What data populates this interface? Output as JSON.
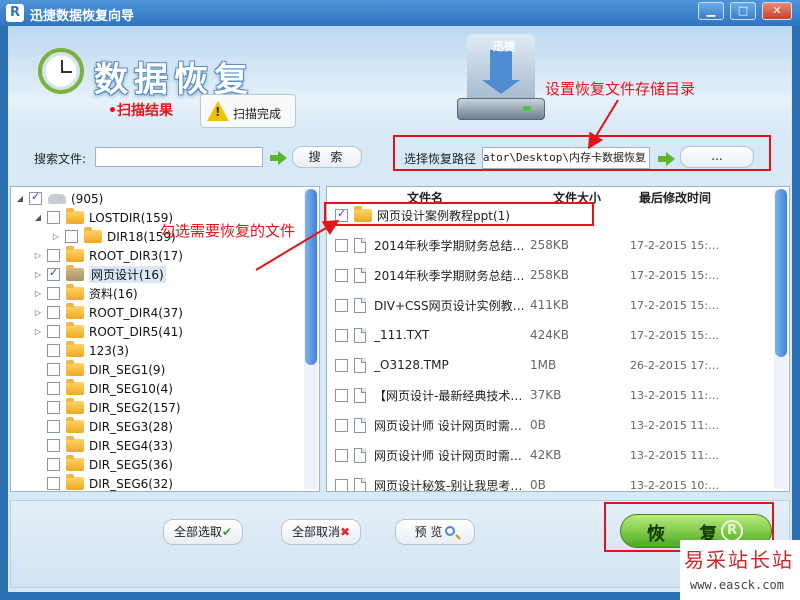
{
  "window": {
    "title": "迅捷数据恢复向导",
    "logo_letter": "R",
    "min": "▁",
    "max": "□",
    "close": "✕"
  },
  "header": {
    "big_title": "数据恢复",
    "scan_result": "•扫描结果",
    "scan_status": "扫描完成",
    "hdd_label": "迅捷"
  },
  "search": {
    "label": "搜索文件:",
    "value": "",
    "button": "搜 索"
  },
  "path": {
    "label": "选择恢复路径",
    "value": "C:\\Users\\Administrator\\Desktop\\内存卡数据恢复",
    "browse": "..."
  },
  "tree": [
    {
      "label": "(905)",
      "checked": true,
      "expander": "◢",
      "indent": 0,
      "icon": "drive-icon"
    },
    {
      "label": "LOSTDIR(159)",
      "checked": false,
      "expander": "◢",
      "indent": 1,
      "icon": "folder-icon"
    },
    {
      "label": "DIR18(159)",
      "checked": false,
      "expander": "▷",
      "indent": 2,
      "icon": "folder-icon"
    },
    {
      "label": "ROOT_DIR3(17)",
      "checked": false,
      "expander": "▷",
      "indent": 1,
      "icon": "folder-icon"
    },
    {
      "label": "网页设计(16)",
      "checked": true,
      "expander": "▷",
      "indent": 1,
      "icon": "folder-open-icon",
      "selected": true
    },
    {
      "label": "资料(16)",
      "checked": false,
      "expander": "▷",
      "indent": 1,
      "icon": "folder-icon"
    },
    {
      "label": "ROOT_DIR4(37)",
      "checked": false,
      "expander": "▷",
      "indent": 1,
      "icon": "folder-icon"
    },
    {
      "label": "ROOT_DIR5(41)",
      "checked": false,
      "expander": "▷",
      "indent": 1,
      "icon": "folder-icon"
    },
    {
      "label": "123(3)",
      "checked": false,
      "expander": "",
      "indent": 1,
      "icon": "folder-icon"
    },
    {
      "label": "DIR_SEG1(9)",
      "checked": false,
      "expander": "",
      "indent": 1,
      "icon": "folder-icon"
    },
    {
      "label": "DIR_SEG10(4)",
      "checked": false,
      "expander": "",
      "indent": 1,
      "icon": "folder-icon"
    },
    {
      "label": "DIR_SEG2(157)",
      "checked": false,
      "expander": "",
      "indent": 1,
      "icon": "folder-icon"
    },
    {
      "label": "DIR_SEG3(28)",
      "checked": false,
      "expander": "",
      "indent": 1,
      "icon": "folder-icon"
    },
    {
      "label": "DIR_SEG4(33)",
      "checked": false,
      "expander": "",
      "indent": 1,
      "icon": "folder-icon"
    },
    {
      "label": "DIR_SEG5(36)",
      "checked": false,
      "expander": "",
      "indent": 1,
      "icon": "folder-icon"
    },
    {
      "label": "DIR_SEG6(32)",
      "checked": false,
      "expander": "",
      "indent": 1,
      "icon": "folder-icon"
    }
  ],
  "files": {
    "columns": {
      "name": "文件名",
      "size": "文件大小",
      "date": "最后修改时间"
    },
    "rows": [
      {
        "name": "网页设计案例教程ppt(1)",
        "size": "",
        "date": "",
        "checked": true,
        "icon": "folder-icon"
      },
      {
        "name": "2014年秋季学期财务总结…",
        "size": "258KB",
        "date": "17-2-2015 15:…",
        "checked": false,
        "icon": "document-icon"
      },
      {
        "name": "2014年秋季学期财务总结…",
        "size": "258KB",
        "date": "17-2-2015 15:…",
        "checked": false,
        "icon": "document-icon"
      },
      {
        "name": "DIV+CSS网页设计实例教…",
        "size": "411KB",
        "date": "17-2-2015 15:…",
        "checked": false,
        "icon": "document-icon"
      },
      {
        "name": "_111.TXT",
        "size": "424KB",
        "date": "17-2-2015 15:…",
        "checked": false,
        "icon": "document-icon"
      },
      {
        "name": "_O3128.TMP",
        "size": "1MB",
        "date": "26-2-2015 17:…",
        "checked": false,
        "icon": "document-icon"
      },
      {
        "name": "【网页设计-最新经典技术…",
        "size": "37KB",
        "date": "13-2-2015 11:…",
        "checked": false,
        "icon": "document-icon"
      },
      {
        "name": "网页设计师 设计网页时需…",
        "size": "0B",
        "date": "13-2-2015 11:…",
        "checked": false,
        "icon": "document-icon"
      },
      {
        "name": "网页设计师 设计网页时需…",
        "size": "42KB",
        "date": "13-2-2015 11:…",
        "checked": false,
        "icon": "document-icon"
      },
      {
        "name": "网页设计秘笈-别让我思考…",
        "size": "0B",
        "date": "13-2-2015 10:…",
        "checked": false,
        "icon": "document-icon"
      }
    ]
  },
  "bottom": {
    "select_all": "全部选取",
    "deselect_all": "全部取消",
    "preview": "预 览",
    "recover": "恢 复",
    "recover_badge": "R"
  },
  "annotations": {
    "set_dir": "设置恢复文件存储目录",
    "check_files": "勾选需要恢复的文件"
  },
  "watermark": {
    "title": "易采站长站",
    "url": "www.easck.com"
  },
  "colors": {
    "accent": "#2f74c0",
    "annotation": "#e1141a",
    "recover_button": "#4aa91f"
  }
}
